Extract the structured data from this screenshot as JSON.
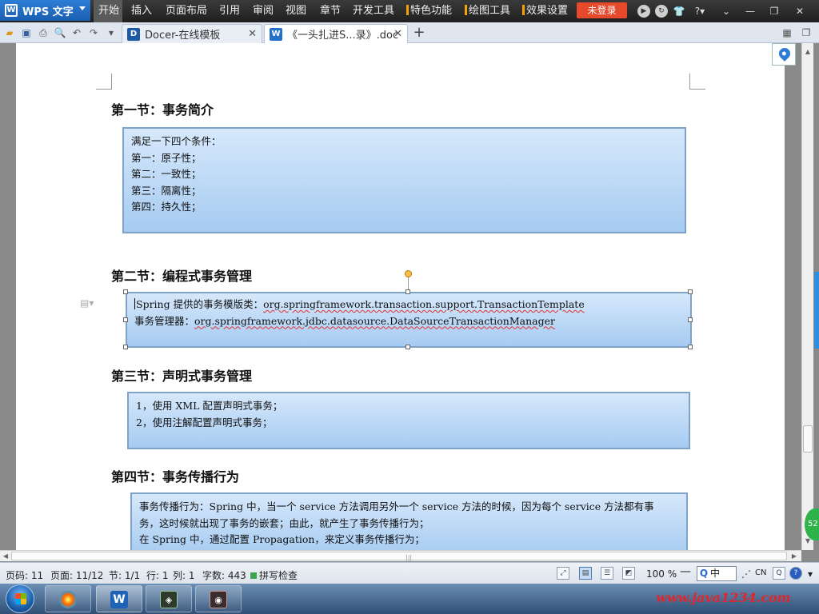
{
  "app": {
    "name": "WPS 文字"
  },
  "menu": {
    "items": [
      "开始",
      "插入",
      "页面布局",
      "引用",
      "审阅",
      "视图",
      "章节",
      "开发工具"
    ],
    "feature_items": [
      "特色功能",
      "绘图工具",
      "效果设置"
    ],
    "login_label": "未登录"
  },
  "tabs": [
    {
      "icon": "D",
      "label": "Docer-在线模板"
    },
    {
      "icon": "W",
      "label": "《一头扎进S...录》.doc"
    }
  ],
  "document": {
    "sections": [
      {
        "heading": "第一节：事务简介",
        "lines": [
          "满足一下四个条件：",
          "第一：原子性；",
          "第二：一致性；",
          "第三：隔离性；",
          "第四：持久性；"
        ]
      },
      {
        "heading": "第二节：编程式事务管理",
        "line1": {
          "prefix": "Spring 提供的事务模版类：",
          "value": "org.springframework.transaction.support.TransactionTemplate"
        },
        "line2": {
          "prefix": "事务管理器：",
          "value": "org.springframework.jdbc.datasource.DataSourceTransactionManager"
        }
      },
      {
        "heading": "第三节：声明式事务管理",
        "lines": [
          "1，使用 XML 配置声明式事务；",
          "2，使用注解配置声明式事务；"
        ]
      },
      {
        "heading": "第四节：事务传播行为",
        "lines": [
          "事务传播行为：Spring 中，当一个 service 方法调用另外一个 service 方法的时候，因为每个 service 方法都有事",
          "务，这时候就出现了事务的嵌套；由此，就产生了事务传播行为；",
          "在 Spring 中，通过配置 Propagation，来定义事务传播行为；"
        ]
      }
    ]
  },
  "status": {
    "page_number": "页码: 11",
    "pages": "页面: 11/12",
    "section": "节: 1/1",
    "row": "行: 1",
    "column": "列: 1",
    "word_count": "字数: 443",
    "spell_check": "拼写检查",
    "zoom": "100 %",
    "ime_mode": "中",
    "lang": "CN"
  },
  "side_badge": "52",
  "watermark": "www.java1234.com",
  "colors": {
    "menubar": "#2a2a2a",
    "app_button": "#2471c7",
    "login": "#e6492c",
    "feature_marker": "#f4a20a",
    "box_fill": "#b8d6f6",
    "box_border": "#7fa2c8"
  },
  "icons": [
    "open-icon",
    "save-icon",
    "print-icon",
    "print-preview-icon",
    "undo-icon",
    "redo-icon",
    "customize-icon",
    "help-icon",
    "map-pin-icon",
    "spell-check-icon",
    "zoom-out-icon",
    "start-orb-icon"
  ]
}
